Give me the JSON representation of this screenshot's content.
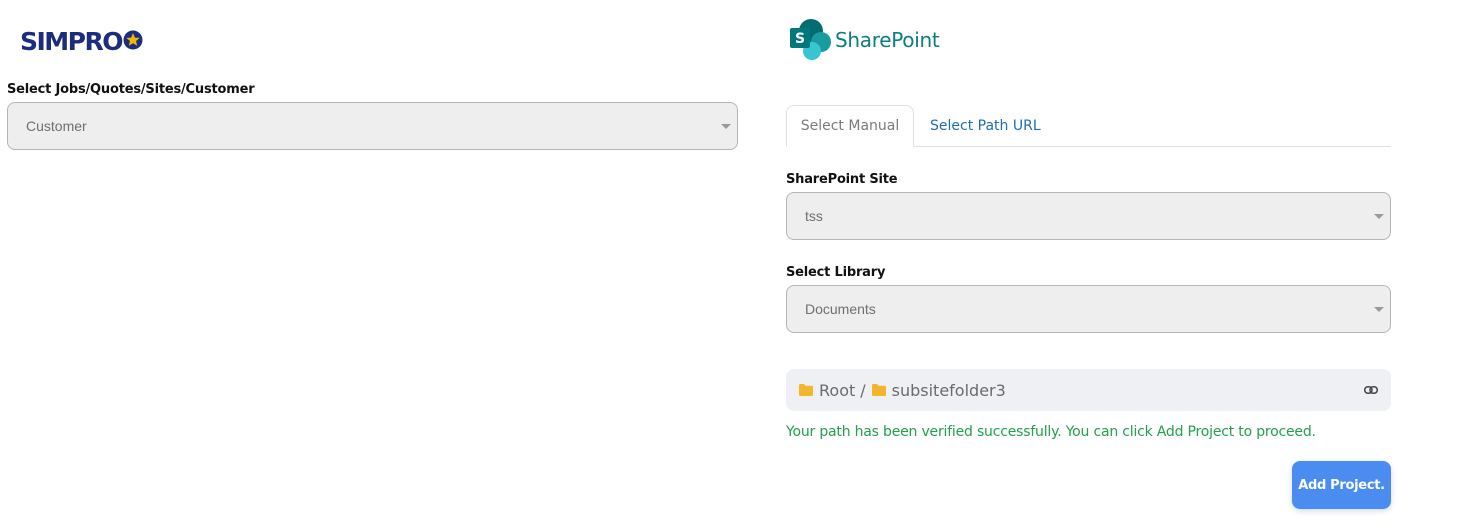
{
  "brand_left": {
    "name": "SIMPRO",
    "star_color": "#f2b705",
    "text_color": "#1b2d7c"
  },
  "brand_right": {
    "name": "SharePoint",
    "icon": "sharepoint-icon",
    "icon_letter": "S",
    "color": "#0b7e80"
  },
  "left_form": {
    "type_label": "Select Jobs/Quotes/Sites/Customer",
    "type_value": "Customer"
  },
  "tabs": [
    {
      "label": "Select Manual",
      "active": true
    },
    {
      "label": "Select Path URL",
      "active": false
    }
  ],
  "sharepoint_form": {
    "site_label": "SharePoint Site",
    "site_value": "tss",
    "library_label": "Select Library",
    "library_value": "Documents"
  },
  "path": {
    "crumbs": [
      "Root",
      "subsitefolder3"
    ],
    "separator": "/",
    "folder_icon_color": "#f2b52c",
    "link_icon": "link-icon"
  },
  "status": {
    "message": "Your path has been verified successfully. You can click Add Project to proceed.",
    "color": "#23a04a"
  },
  "actions": {
    "add_project_label": "Add Project.",
    "button_color": "#4a8cf0"
  }
}
